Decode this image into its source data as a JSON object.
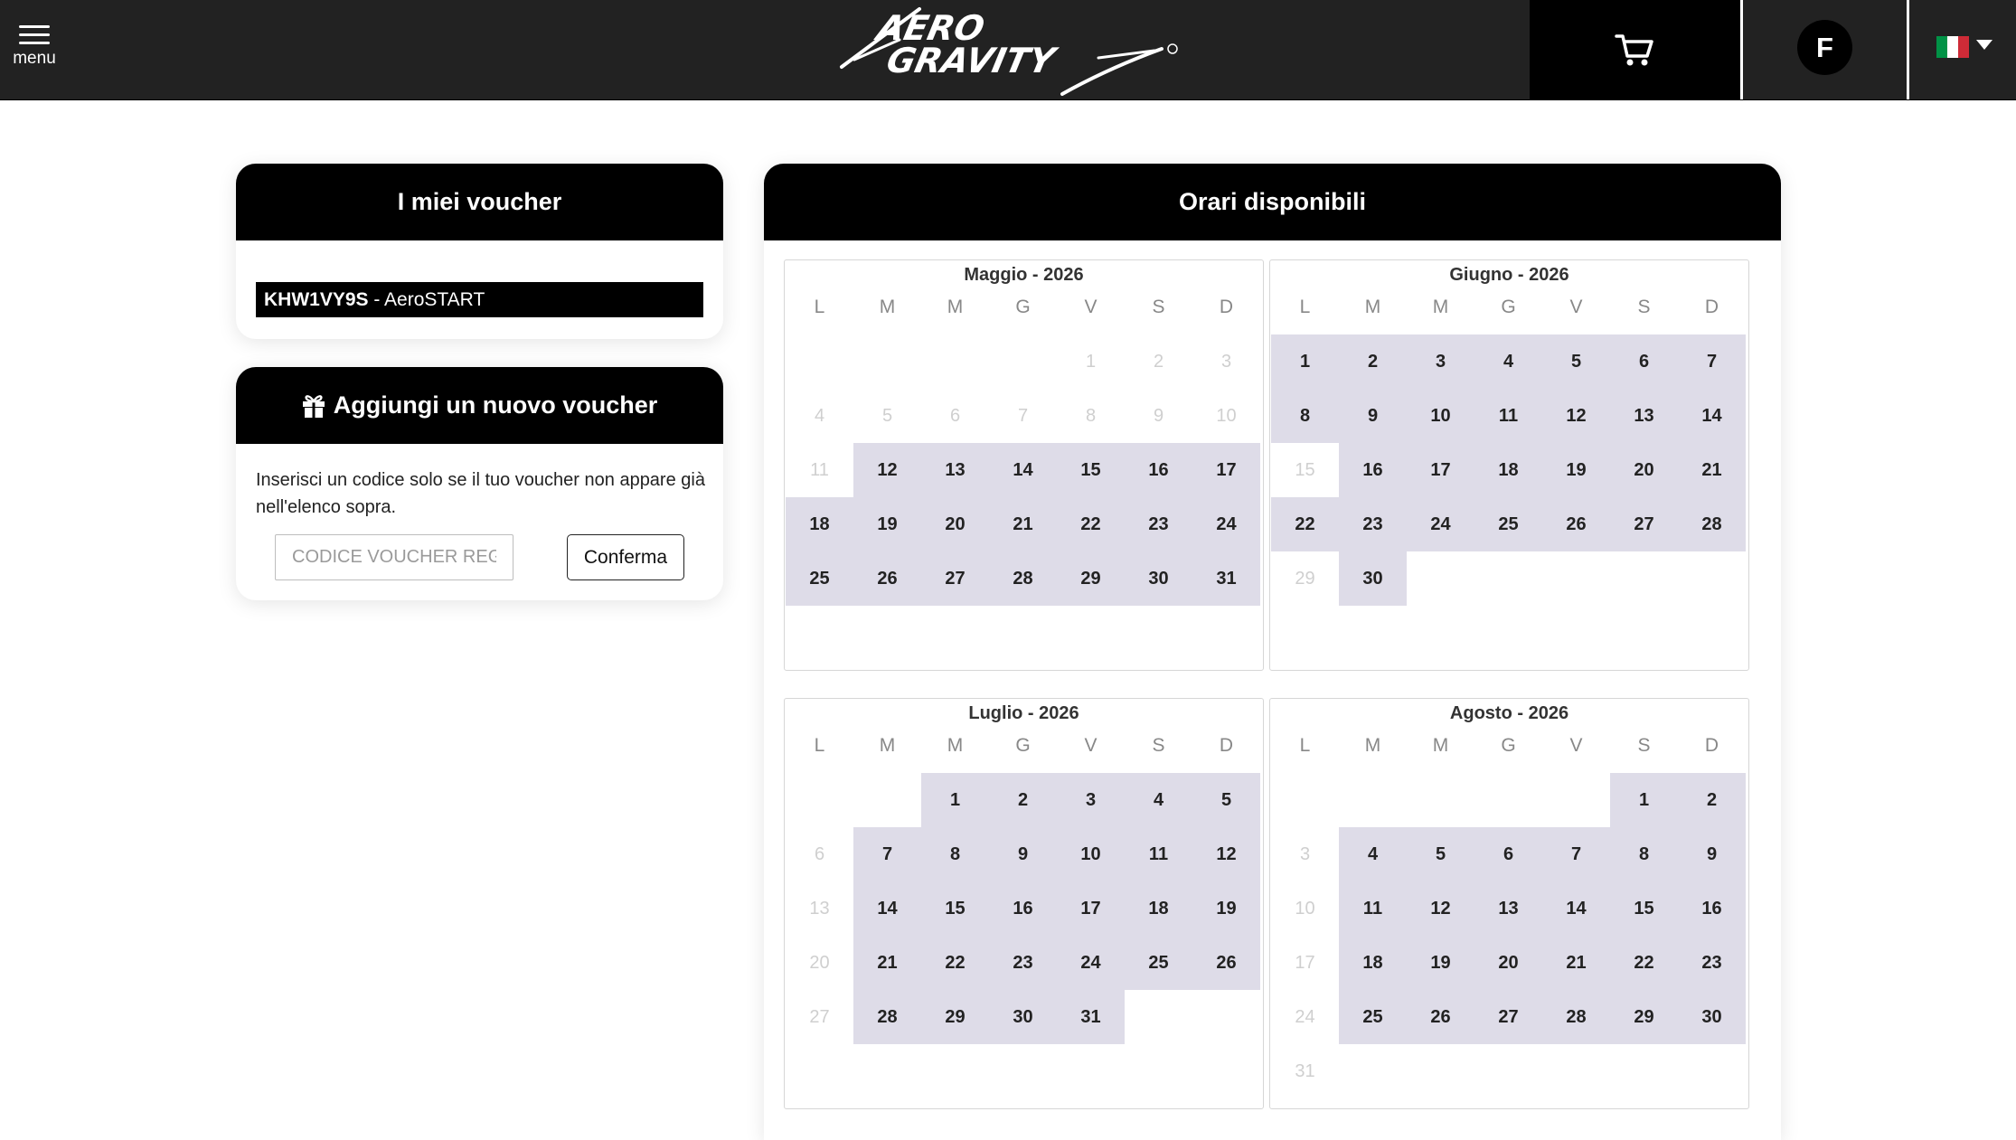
{
  "header": {
    "menu_label": "menu",
    "brand": "AeroGravity",
    "user_initial": "F",
    "language": "Italiano",
    "flag_colors": [
      "#009246",
      "#ffffff",
      "#ce2b37"
    ]
  },
  "my_vouchers": {
    "title": "I miei voucher",
    "items": [
      {
        "code": "KHW1VY9S",
        "label": " - AeroSTART"
      }
    ]
  },
  "add_voucher": {
    "title": "Aggiungi un nuovo voucher",
    "help_text": "Inserisci un codice solo se il tuo voucher non appare già nell'elenco sopra.",
    "input_placeholder": "CODICE VOUCHER REGALO",
    "confirm_label": "Conferma"
  },
  "calendar": {
    "title": "Orari disponibili",
    "weekdays": [
      "L",
      "M",
      "M",
      "G",
      "V",
      "S",
      "D"
    ],
    "colors": {
      "available_bg": "#dedce8",
      "past_text": "#cfcfcf"
    },
    "months": [
      {
        "title": "Maggio - 2026",
        "weeks": [
          [
            null,
            null,
            null,
            null,
            {
              "d": "1",
              "s": "past"
            },
            {
              "d": "2",
              "s": "past"
            },
            {
              "d": "3",
              "s": "past"
            }
          ],
          [
            {
              "d": "4",
              "s": "past"
            },
            {
              "d": "5",
              "s": "past"
            },
            {
              "d": "6",
              "s": "past"
            },
            {
              "d": "7",
              "s": "past"
            },
            {
              "d": "8",
              "s": "past"
            },
            {
              "d": "9",
              "s": "past"
            },
            {
              "d": "10",
              "s": "past"
            }
          ],
          [
            {
              "d": "11",
              "s": "past"
            },
            {
              "d": "12",
              "s": "avail"
            },
            {
              "d": "13",
              "s": "avail"
            },
            {
              "d": "14",
              "s": "avail"
            },
            {
              "d": "15",
              "s": "avail"
            },
            {
              "d": "16",
              "s": "avail"
            },
            {
              "d": "17",
              "s": "avail"
            }
          ],
          [
            {
              "d": "18",
              "s": "avail"
            },
            {
              "d": "19",
              "s": "avail"
            },
            {
              "d": "20",
              "s": "avail"
            },
            {
              "d": "21",
              "s": "avail"
            },
            {
              "d": "22",
              "s": "avail"
            },
            {
              "d": "23",
              "s": "avail"
            },
            {
              "d": "24",
              "s": "avail"
            }
          ],
          [
            {
              "d": "25",
              "s": "avail"
            },
            {
              "d": "26",
              "s": "avail"
            },
            {
              "d": "27",
              "s": "avail"
            },
            {
              "d": "28",
              "s": "avail"
            },
            {
              "d": "29",
              "s": "avail"
            },
            {
              "d": "30",
              "s": "avail"
            },
            {
              "d": "31",
              "s": "avail"
            }
          ]
        ]
      },
      {
        "title": "Giugno - 2026",
        "weeks": [
          [
            {
              "d": "1",
              "s": "avail"
            },
            {
              "d": "2",
              "s": "avail"
            },
            {
              "d": "3",
              "s": "avail"
            },
            {
              "d": "4",
              "s": "avail"
            },
            {
              "d": "5",
              "s": "avail"
            },
            {
              "d": "6",
              "s": "avail"
            },
            {
              "d": "7",
              "s": "avail"
            }
          ],
          [
            {
              "d": "8",
              "s": "avail"
            },
            {
              "d": "9",
              "s": "avail"
            },
            {
              "d": "10",
              "s": "avail"
            },
            {
              "d": "11",
              "s": "avail"
            },
            {
              "d": "12",
              "s": "avail"
            },
            {
              "d": "13",
              "s": "avail"
            },
            {
              "d": "14",
              "s": "avail"
            }
          ],
          [
            {
              "d": "15",
              "s": "past"
            },
            {
              "d": "16",
              "s": "avail"
            },
            {
              "d": "17",
              "s": "avail"
            },
            {
              "d": "18",
              "s": "avail"
            },
            {
              "d": "19",
              "s": "avail"
            },
            {
              "d": "20",
              "s": "avail"
            },
            {
              "d": "21",
              "s": "avail"
            }
          ],
          [
            {
              "d": "22",
              "s": "avail"
            },
            {
              "d": "23",
              "s": "avail"
            },
            {
              "d": "24",
              "s": "avail"
            },
            {
              "d": "25",
              "s": "avail"
            },
            {
              "d": "26",
              "s": "avail"
            },
            {
              "d": "27",
              "s": "avail"
            },
            {
              "d": "28",
              "s": "avail"
            }
          ],
          [
            {
              "d": "29",
              "s": "past"
            },
            {
              "d": "30",
              "s": "avail"
            },
            null,
            null,
            null,
            null,
            null
          ]
        ]
      },
      {
        "title": "Luglio - 2026",
        "weeks": [
          [
            null,
            null,
            {
              "d": "1",
              "s": "avail"
            },
            {
              "d": "2",
              "s": "avail"
            },
            {
              "d": "3",
              "s": "avail"
            },
            {
              "d": "4",
              "s": "avail"
            },
            {
              "d": "5",
              "s": "avail"
            }
          ],
          [
            {
              "d": "6",
              "s": "past"
            },
            {
              "d": "7",
              "s": "avail"
            },
            {
              "d": "8",
              "s": "avail"
            },
            {
              "d": "9",
              "s": "avail"
            },
            {
              "d": "10",
              "s": "avail"
            },
            {
              "d": "11",
              "s": "avail"
            },
            {
              "d": "12",
              "s": "avail"
            }
          ],
          [
            {
              "d": "13",
              "s": "past"
            },
            {
              "d": "14",
              "s": "avail"
            },
            {
              "d": "15",
              "s": "avail"
            },
            {
              "d": "16",
              "s": "avail"
            },
            {
              "d": "17",
              "s": "avail"
            },
            {
              "d": "18",
              "s": "avail"
            },
            {
              "d": "19",
              "s": "avail"
            }
          ],
          [
            {
              "d": "20",
              "s": "past"
            },
            {
              "d": "21",
              "s": "avail"
            },
            {
              "d": "22",
              "s": "avail"
            },
            {
              "d": "23",
              "s": "avail"
            },
            {
              "d": "24",
              "s": "avail"
            },
            {
              "d": "25",
              "s": "avail"
            },
            {
              "d": "26",
              "s": "avail"
            }
          ],
          [
            {
              "d": "27",
              "s": "past"
            },
            {
              "d": "28",
              "s": "avail"
            },
            {
              "d": "29",
              "s": "avail"
            },
            {
              "d": "30",
              "s": "avail"
            },
            {
              "d": "31",
              "s": "avail"
            },
            null,
            null
          ]
        ]
      },
      {
        "title": "Agosto - 2026",
        "weeks": [
          [
            null,
            null,
            null,
            null,
            null,
            {
              "d": "1",
              "s": "avail"
            },
            {
              "d": "2",
              "s": "avail"
            }
          ],
          [
            {
              "d": "3",
              "s": "past"
            },
            {
              "d": "4",
              "s": "avail"
            },
            {
              "d": "5",
              "s": "avail"
            },
            {
              "d": "6",
              "s": "avail"
            },
            {
              "d": "7",
              "s": "avail"
            },
            {
              "d": "8",
              "s": "avail"
            },
            {
              "d": "9",
              "s": "avail"
            }
          ],
          [
            {
              "d": "10",
              "s": "past"
            },
            {
              "d": "11",
              "s": "avail"
            },
            {
              "d": "12",
              "s": "avail"
            },
            {
              "d": "13",
              "s": "avail"
            },
            {
              "d": "14",
              "s": "avail"
            },
            {
              "d": "15",
              "s": "avail"
            },
            {
              "d": "16",
              "s": "avail"
            }
          ],
          [
            {
              "d": "17",
              "s": "past"
            },
            {
              "d": "18",
              "s": "avail"
            },
            {
              "d": "19",
              "s": "avail"
            },
            {
              "d": "20",
              "s": "avail"
            },
            {
              "d": "21",
              "s": "avail"
            },
            {
              "d": "22",
              "s": "avail"
            },
            {
              "d": "23",
              "s": "avail"
            }
          ],
          [
            {
              "d": "24",
              "s": "past"
            },
            {
              "d": "25",
              "s": "avail"
            },
            {
              "d": "26",
              "s": "avail"
            },
            {
              "d": "27",
              "s": "avail"
            },
            {
              "d": "28",
              "s": "avail"
            },
            {
              "d": "29",
              "s": "avail"
            },
            {
              "d": "30",
              "s": "avail"
            }
          ],
          [
            {
              "d": "31",
              "s": "past"
            },
            null,
            null,
            null,
            null,
            null,
            null
          ]
        ]
      }
    ]
  }
}
